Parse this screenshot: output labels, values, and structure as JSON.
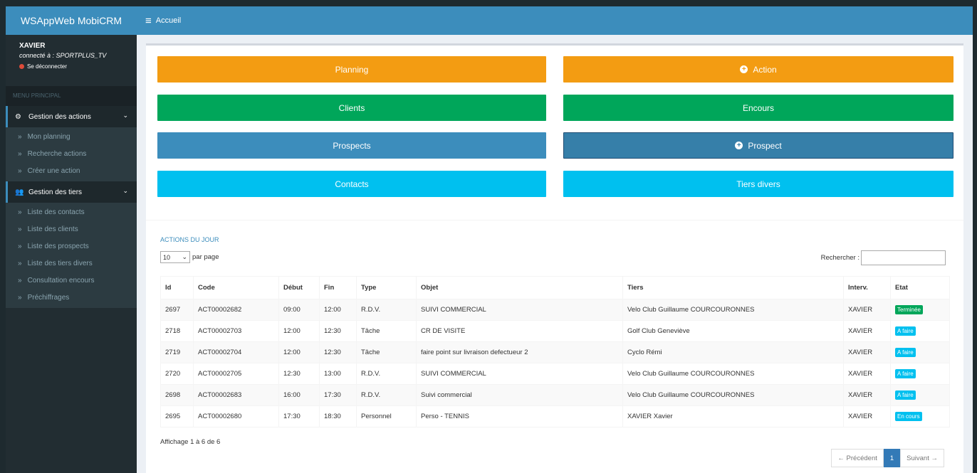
{
  "app": {
    "title": "WSAppWeb MobiCRM"
  },
  "header": {
    "menu_icon": "hamburger-icon",
    "breadcrumb": "Accueil"
  },
  "user": {
    "name": "XAVIER",
    "connection": "connecté à : SPORTPLUS_TV",
    "logout": "Se déconnecter"
  },
  "sidebar": {
    "menu_header": "MENU PRINCIPAL",
    "groups": [
      {
        "label": "Gestion des actions",
        "icon": "gears-icon",
        "items": [
          "Mon planning",
          "Recherche actions",
          "Créer une action"
        ]
      },
      {
        "label": "Gestion des tiers",
        "icon": "users-icon",
        "items": [
          "Liste des contacts",
          "Liste des clients",
          "Liste des prospects",
          "Liste des tiers divers",
          "Consultation encours",
          "Préchiffrages"
        ]
      }
    ]
  },
  "buttons": {
    "planning": "Planning",
    "action": "Action",
    "clients": "Clients",
    "encours": "Encours",
    "prospects": "Prospects",
    "prospect": "Prospect",
    "contacts": "Contacts",
    "tiers_divers": "Tiers divers"
  },
  "colors": {
    "orange": "#f39c12",
    "green": "#00a65a",
    "blue": "#3c8dbc",
    "cyan": "#00c0ef",
    "sidebar": "#222d32"
  },
  "table": {
    "title": "ACTIONS DU JOUR",
    "page_size": "10",
    "per_page_label": "par page",
    "search_label": "Rechercher :",
    "columns": [
      "Id",
      "Code",
      "Début",
      "Fin",
      "Type",
      "Objet",
      "Tiers",
      "Interv.",
      "Etat"
    ],
    "rows": [
      [
        "2697",
        "ACT00002682",
        "09:00",
        "12:00",
        "R.D.V.",
        "SUIVI COMMERCIAL",
        "Velo Club Guillaume COURCOURONNES",
        "XAVIER",
        "Terminée"
      ],
      [
        "2718",
        "ACT00002703",
        "12:00",
        "12:30",
        "Tâche",
        "CR DE VISITE",
        "Golf Club Geneviève",
        "XAVIER",
        "A faire"
      ],
      [
        "2719",
        "ACT00002704",
        "12:00",
        "12:30",
        "Tâche",
        "faire point sur livraison defectueur 2",
        "Cyclo Rémi",
        "XAVIER",
        "A faire"
      ],
      [
        "2720",
        "ACT00002705",
        "12:30",
        "13:00",
        "R.D.V.",
        "SUIVI COMMERCIAL",
        "Velo Club Guillaume COURCOURONNES",
        "XAVIER",
        "A faire"
      ],
      [
        "2698",
        "ACT00002683",
        "16:00",
        "17:30",
        "R.D.V.",
        "Suivi commercial",
        "Velo Club Guillaume COURCOURONNES",
        "XAVIER",
        "A faire"
      ],
      [
        "2695",
        "ACT00002680",
        "17:30",
        "18:30",
        "Personnel",
        "Perso - TENNIS",
        "XAVIER Xavier",
        "XAVIER",
        "En cours"
      ]
    ],
    "info": "Affichage 1 à 6 de 6",
    "pagination": {
      "prev": "← Précédent",
      "page": "1",
      "next": "Suivant →"
    }
  }
}
